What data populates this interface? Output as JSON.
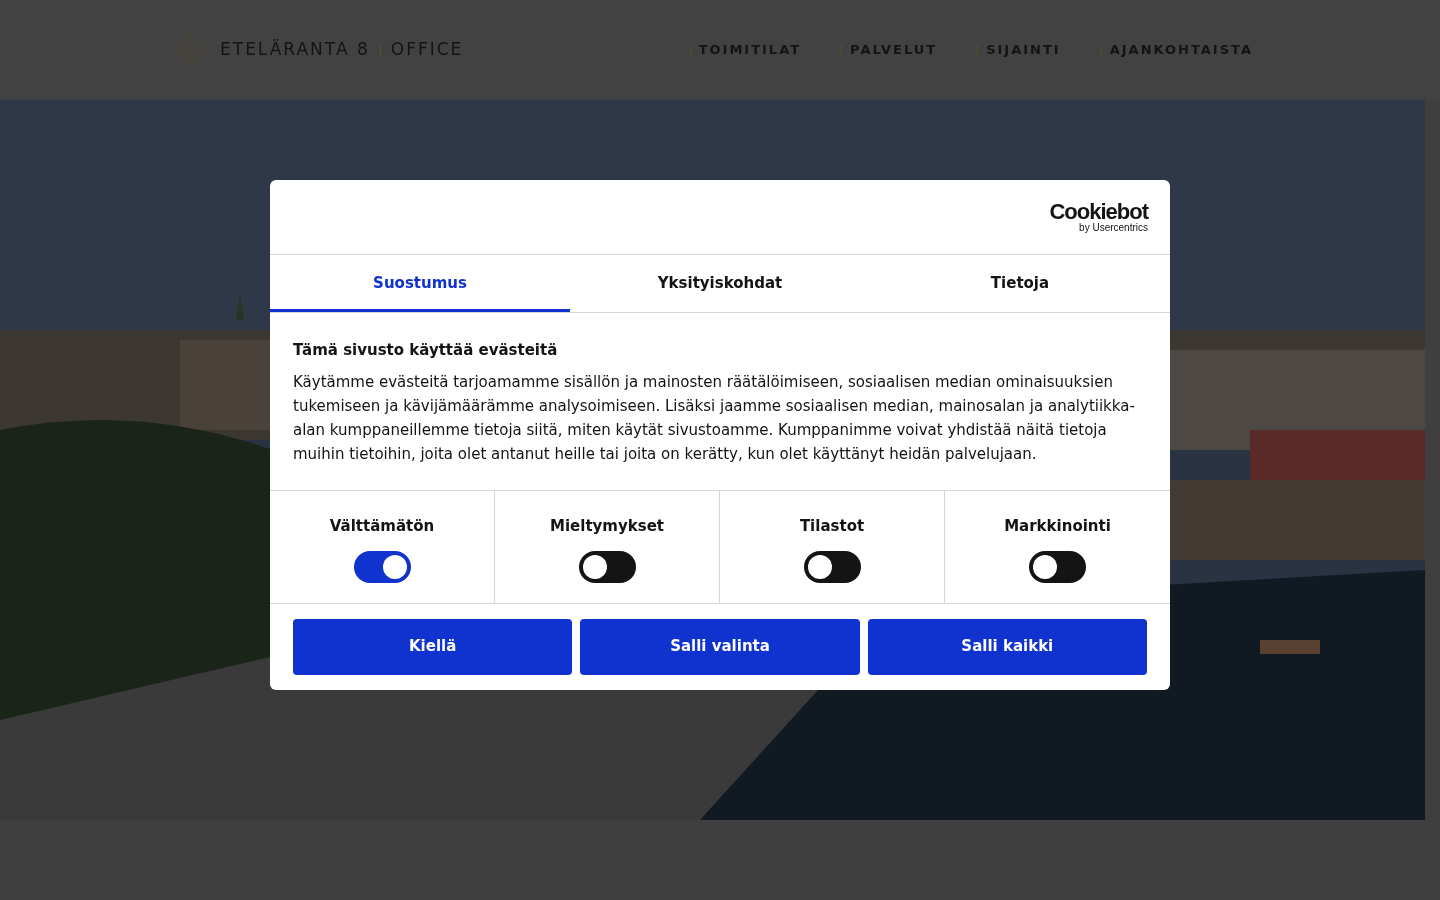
{
  "header": {
    "brand": "ETELÄRANTA 8",
    "brand_suffix": "OFFICE",
    "nav": [
      {
        "label": "TOIMITILAT"
      },
      {
        "label": "PALVELUT"
      },
      {
        "label": "SIJAINTI"
      },
      {
        "label": "AJANKOHTAISTA"
      }
    ]
  },
  "consent": {
    "logo": "Cookiebot",
    "logo_sub": "by Usercentrics",
    "tabs": [
      {
        "label": "Suostumus",
        "selected": true
      },
      {
        "label": "Yksityiskohdat",
        "selected": false
      },
      {
        "label": "Tietoja",
        "selected": false
      }
    ],
    "title": "Tämä sivusto käyttää evästeitä",
    "body": "Käytämme evästeitä tarjoamamme sisällön ja mainosten räätälöimiseen, sosiaalisen median ominaisuuksien tukemiseen ja kävijämäärämme analysoimiseen. Lisäksi jaamme sosiaalisen median, mainosalan ja analytiikka-alan kumppaneillemme tietoja siitä, miten käytät sivustoamme. Kumppanimme voivat yhdistää näitä tietoja muihin tietoihin, joita olet antanut heille tai joita on kerätty, kun olet käyttänyt heidän palvelujaan.",
    "categories": [
      {
        "label": "Välttämätön",
        "on": true
      },
      {
        "label": "Mieltymykset",
        "on": false
      },
      {
        "label": "Tilastot",
        "on": false
      },
      {
        "label": "Markkinointi",
        "on": false
      }
    ],
    "buttons": [
      "Kiellä",
      "Salli valinta",
      "Salli kaikki"
    ]
  }
}
